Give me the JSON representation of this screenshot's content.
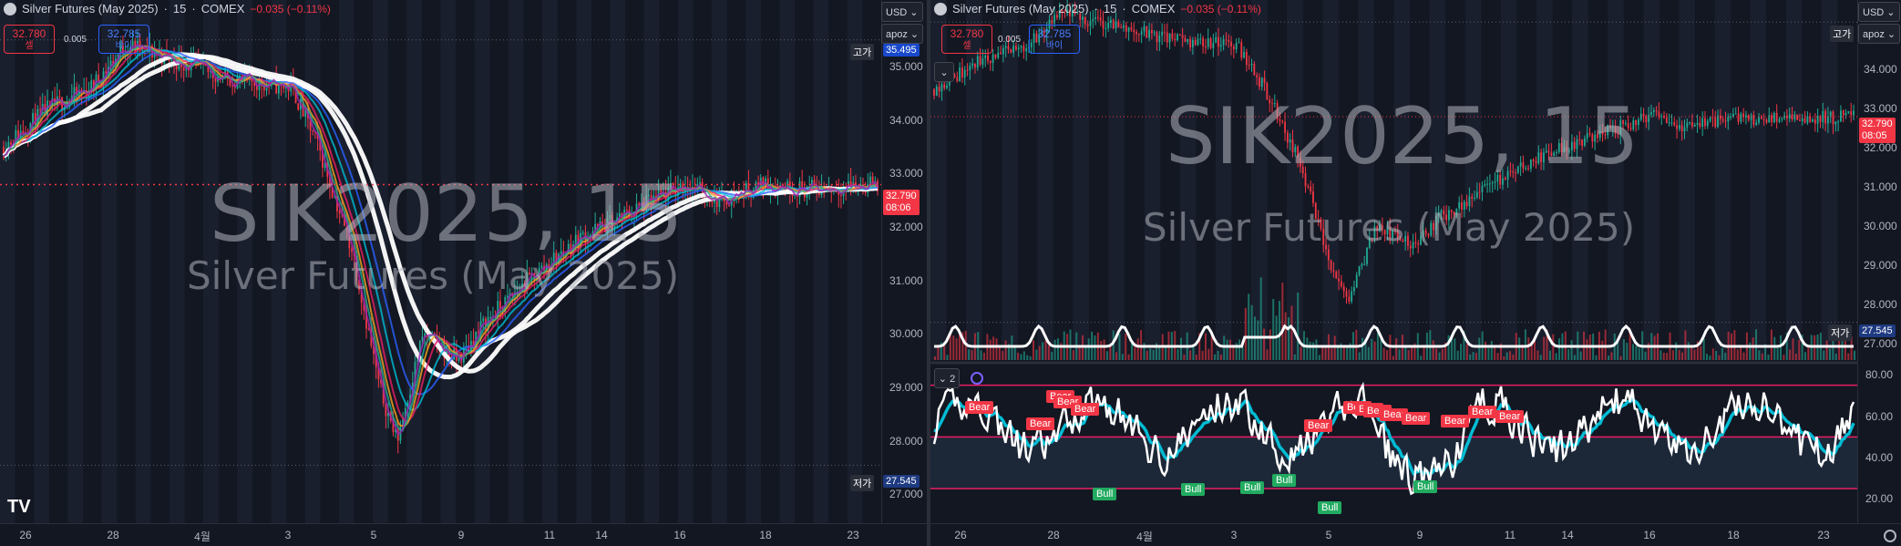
{
  "left": {
    "header": {
      "symbol": "Silver Futures (May 2025)",
      "interval": "15",
      "exchange": "COMEX",
      "change": "−0.035 (−0.11%)"
    },
    "sell": {
      "price": "32.780",
      "label": "셀"
    },
    "buy": {
      "price": "32.785",
      "label": "바이"
    },
    "spread": "0.005",
    "currency": "USD",
    "script_btn": "apoz",
    "watermark": {
      "symbol": "SIK2025, 15",
      "name": "Silver Futures (May 2025)"
    },
    "yticks": [
      "35.000",
      "34.000",
      "33.000",
      "32.000",
      "31.000",
      "30.000",
      "29.000",
      "28.000",
      "27.000"
    ],
    "high_label": "고가",
    "high_value": "35.495",
    "low_label": "저가",
    "low_value": "27.545",
    "last_price": "32.790",
    "countdown": "08:06",
    "xticks": [
      "26",
      "28",
      "4월",
      "3",
      "5",
      "9",
      "11",
      "14",
      "16",
      "18",
      "23"
    ],
    "logo_text": "TV"
  },
  "right": {
    "header": {
      "symbol": "Silver Futures (May 2025)",
      "interval": "15",
      "exchange": "COMEX",
      "change": "−0.035 (−0.11%)"
    },
    "sell": {
      "price": "32.780",
      "label": "셀"
    },
    "buy": {
      "price": "32.785",
      "label": "바이"
    },
    "spread": "0.005",
    "currency": "USD",
    "script_btn": "apoz",
    "collapse": "⌄",
    "watermark": {
      "symbol": "SIK2025, 15",
      "name": "Silver Futures (May 2025)"
    },
    "yticks": [
      "35.000",
      "34.000",
      "33.000",
      "32.000",
      "31.000",
      "30.000",
      "29.000",
      "28.000",
      "27.000"
    ],
    "high_label": "고가",
    "low_label": "저가",
    "low_value": "27.545",
    "last_price": "32.790",
    "countdown": "08:05",
    "indicator": {
      "count": "2",
      "yticks": [
        "80.00",
        "60.00",
        "40.00",
        "20.00"
      ]
    },
    "bear_tags": [
      "Bear",
      "Bear",
      "Bear",
      "Bear",
      "Bear",
      "Bear",
      "Bear",
      "Bear",
      "Bear",
      "Bear",
      "Bear",
      "Bear",
      "Bear",
      "Bear"
    ],
    "bull_tags": [
      "Bull",
      "Bull",
      "Bull",
      "Bull",
      "Bull",
      "Bull"
    ],
    "xticks": [
      "26",
      "28",
      "4월",
      "3",
      "5",
      "9",
      "11",
      "14",
      "16",
      "18",
      "23"
    ]
  },
  "colors": {
    "bg": "#131722",
    "up": "#22ab94",
    "down": "#f23645",
    "accent": "#2962ff",
    "stoch": "#00bcd4",
    "band": "#e91e63"
  }
}
